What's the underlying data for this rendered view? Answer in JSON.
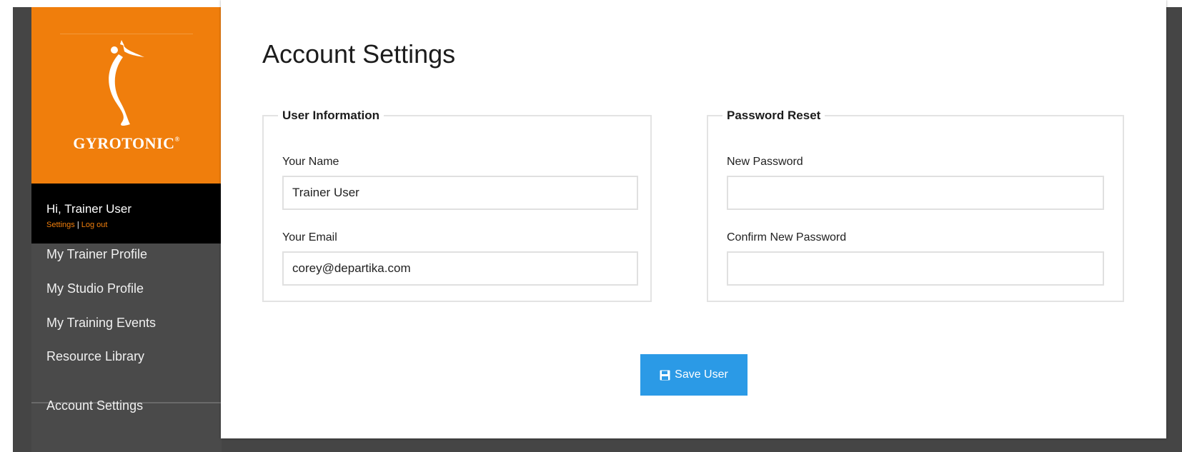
{
  "brand": {
    "name": "GYROTONIC",
    "mark": "®"
  },
  "user": {
    "greeting": "Hi, Trainer User",
    "settings_link": "Settings",
    "separator": "|",
    "logout_link": "Log out"
  },
  "sidebar": {
    "items": [
      {
        "label": "My Trainer Profile"
      },
      {
        "label": "My Studio Profile"
      },
      {
        "label": "My Training Events"
      },
      {
        "label": "Resource Library"
      },
      {
        "label": "Account Settings"
      }
    ]
  },
  "main": {
    "title": "Account Settings",
    "user_info": {
      "legend": "User Information",
      "name_label": "Your Name",
      "name_value": "Trainer User",
      "email_label": "Your Email",
      "email_value": "corey@departika.com"
    },
    "password_reset": {
      "legend": "Password Reset",
      "new_label": "New Password",
      "new_value": "",
      "confirm_label": "Confirm New Password",
      "confirm_value": ""
    },
    "save_button": {
      "label": "Save User",
      "icon": "floppy-disk-icon"
    }
  },
  "colors": {
    "brand_orange": "#f07e0c",
    "sidebar_bg": "#4a4a4a",
    "button_blue": "#2b9ae6"
  }
}
